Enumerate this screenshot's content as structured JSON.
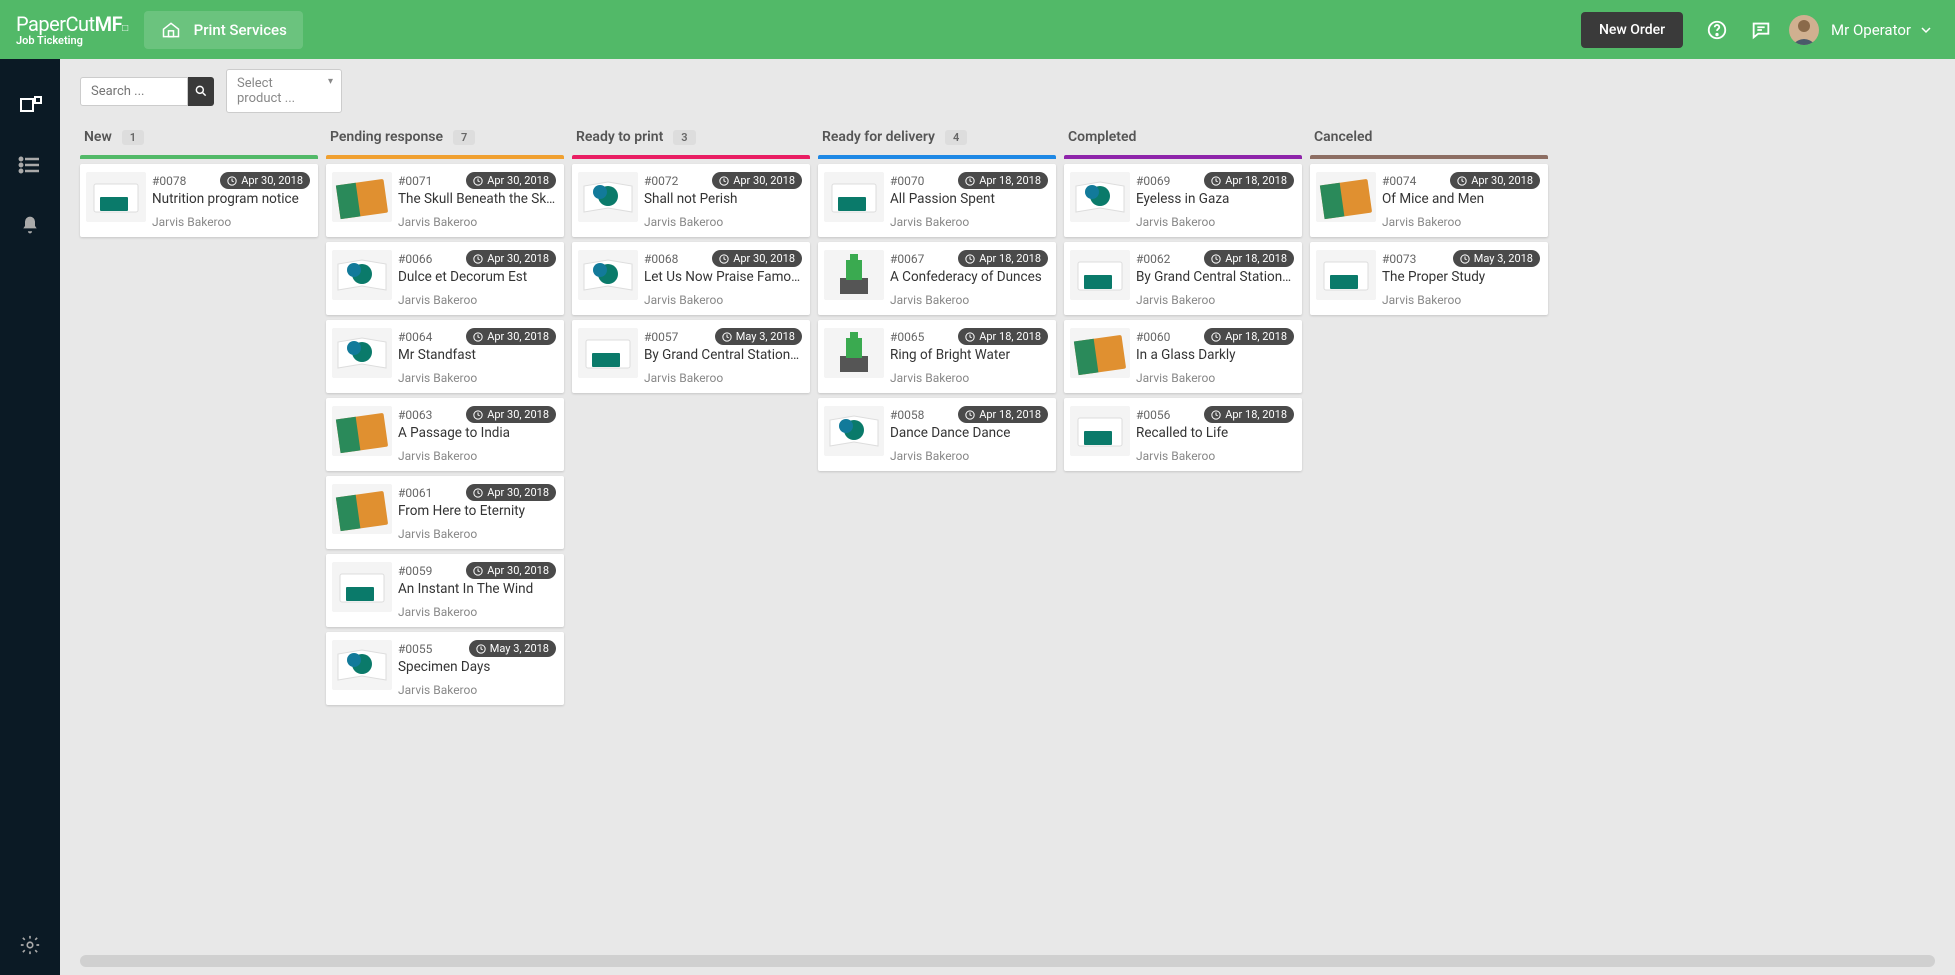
{
  "header": {
    "brand_main": "PaperCut",
    "brand_suffix": "MF",
    "brand_sub": "Job Ticketing",
    "tab_label": "Print Services",
    "new_order": "New Order",
    "user_name": "Mr Operator"
  },
  "filter": {
    "search_placeholder": "Search ...",
    "select_placeholder": "Select product ..."
  },
  "columns": [
    {
      "title": "New",
      "count": "1",
      "stripe": "c-green",
      "cards": [
        {
          "id": "#0078",
          "date": "Apr 30, 2018",
          "title": "Nutrition program notice",
          "author": "Jarvis Bakeroo",
          "thumb": "card"
        }
      ]
    },
    {
      "title": "Pending response",
      "count": "7",
      "stripe": "c-orange",
      "cards": [
        {
          "id": "#0071",
          "date": "Apr 30, 2018",
          "title": "The Skull Beneath the Skin",
          "author": "Jarvis Bakeroo",
          "thumb": "booklet"
        },
        {
          "id": "#0066",
          "date": "Apr 30, 2018",
          "title": "Dulce et Decorum Est",
          "author": "Jarvis Bakeroo",
          "thumb": "brochure"
        },
        {
          "id": "#0064",
          "date": "Apr 30, 2018",
          "title": "Mr Standfast",
          "author": "Jarvis Bakeroo",
          "thumb": "brochure"
        },
        {
          "id": "#0063",
          "date": "Apr 30, 2018",
          "title": "A Passage to India",
          "author": "Jarvis Bakeroo",
          "thumb": "booklet"
        },
        {
          "id": "#0061",
          "date": "Apr 30, 2018",
          "title": "From Here to Eternity",
          "author": "Jarvis Bakeroo",
          "thumb": "booklet"
        },
        {
          "id": "#0059",
          "date": "Apr 30, 2018",
          "title": "An Instant In The Wind",
          "author": "Jarvis Bakeroo",
          "thumb": "card"
        },
        {
          "id": "#0055",
          "date": "May 3, 2018",
          "title": "Specimen Days",
          "author": "Jarvis Bakeroo",
          "thumb": "brochure"
        }
      ]
    },
    {
      "title": "Ready to print",
      "count": "3",
      "stripe": "c-pink",
      "cards": [
        {
          "id": "#0072",
          "date": "Apr 30, 2018",
          "title": "Shall not Perish",
          "author": "Jarvis Bakeroo",
          "thumb": "brochure"
        },
        {
          "id": "#0068",
          "date": "Apr 30, 2018",
          "title": "Let Us Now Praise Famous ...",
          "author": "Jarvis Bakeroo",
          "thumb": "brochure"
        },
        {
          "id": "#0057",
          "date": "May 3, 2018",
          "title": "By Grand Central Station I S...",
          "author": "Jarvis Bakeroo",
          "thumb": "card"
        }
      ]
    },
    {
      "title": "Ready for delivery",
      "count": "4",
      "stripe": "c-blue",
      "cards": [
        {
          "id": "#0070",
          "date": "Apr 18, 2018",
          "title": "All Passion Spent",
          "author": "Jarvis Bakeroo",
          "thumb": "card"
        },
        {
          "id": "#0067",
          "date": "Apr 18, 2018",
          "title": "A Confederacy of Dunces",
          "author": "Jarvis Bakeroo",
          "thumb": "printer"
        },
        {
          "id": "#0065",
          "date": "Apr 18, 2018",
          "title": "Ring of Bright Water",
          "author": "Jarvis Bakeroo",
          "thumb": "printer"
        },
        {
          "id": "#0058",
          "date": "Apr 18, 2018",
          "title": "Dance Dance Dance",
          "author": "Jarvis Bakeroo",
          "thumb": "brochure"
        }
      ]
    },
    {
      "title": "Completed",
      "count": "",
      "stripe": "c-purple",
      "cards": [
        {
          "id": "#0069",
          "date": "Apr 18, 2018",
          "title": "Eyeless in Gaza",
          "author": "Jarvis Bakeroo",
          "thumb": "brochure"
        },
        {
          "id": "#0062",
          "date": "Apr 18, 2018",
          "title": "By Grand Central Station I S...",
          "author": "Jarvis Bakeroo",
          "thumb": "card"
        },
        {
          "id": "#0060",
          "date": "Apr 18, 2018",
          "title": "In a Glass Darkly",
          "author": "Jarvis Bakeroo",
          "thumb": "booklet"
        },
        {
          "id": "#0056",
          "date": "Apr 18, 2018",
          "title": "Recalled to Life",
          "author": "Jarvis Bakeroo",
          "thumb": "card"
        }
      ]
    },
    {
      "title": "Canceled",
      "count": "",
      "stripe": "c-brown",
      "cards": [
        {
          "id": "#0074",
          "date": "Apr 30, 2018",
          "title": "Of Mice and Men",
          "author": "Jarvis Bakeroo",
          "thumb": "booklet"
        },
        {
          "id": "#0073",
          "date": "May 3, 2018",
          "title": "The Proper Study",
          "author": "Jarvis Bakeroo",
          "thumb": "card"
        }
      ]
    }
  ]
}
